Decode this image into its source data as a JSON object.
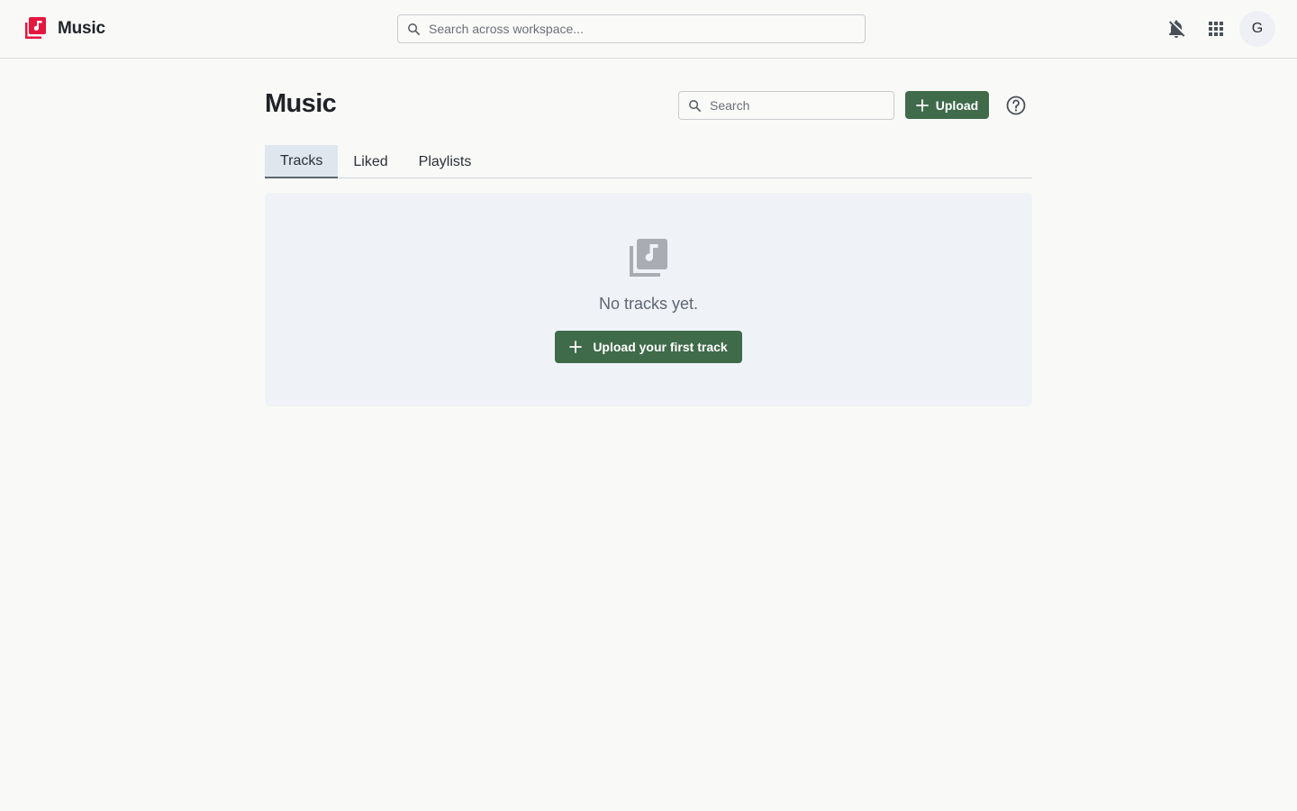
{
  "app": {
    "name": "Music",
    "brand_color": "#e5173f"
  },
  "header": {
    "search_placeholder": "Search across workspace...",
    "avatar_initial": "G",
    "icons": [
      "notifications-off-icon",
      "apps-grid-icon"
    ]
  },
  "page": {
    "title": "Music",
    "search_placeholder": "Search",
    "upload_label": "Upload",
    "accent_color": "#3f6b4a"
  },
  "tabs": [
    {
      "label": "Tracks",
      "active": true
    },
    {
      "label": "Liked",
      "active": false
    },
    {
      "label": "Playlists",
      "active": false
    }
  ],
  "empty_state": {
    "message": "No tracks yet.",
    "button_label": "Upload your first track",
    "icon": "library-music-icon"
  }
}
